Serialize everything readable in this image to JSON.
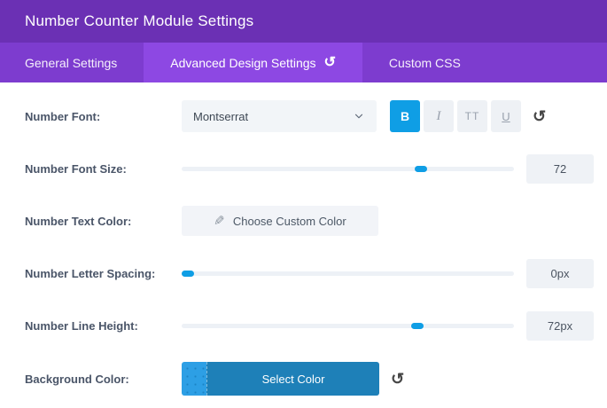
{
  "window": {
    "title": "Number Counter Module Settings"
  },
  "tabs": [
    {
      "label": "General Settings",
      "active": false
    },
    {
      "label": "Advanced Design Settings",
      "active": true,
      "has_reset": true
    },
    {
      "label": "Custom CSS",
      "active": false
    }
  ],
  "icons": {
    "reset": "↺",
    "pencil": "✎"
  },
  "colors": {
    "header_purple": "#6b30b4",
    "tabbar_purple": "#7d3ccf",
    "active_tab_purple": "#8d48e3",
    "accent_blue": "#0f9ee5",
    "swatch_blue": "#2d9fe5",
    "select_color_blue": "#1e80b8"
  },
  "settings": {
    "number_font": {
      "label": "Number Font:",
      "value": "Montserrat",
      "styles": [
        {
          "label": "B",
          "active": true
        },
        {
          "label": "I",
          "active": false
        },
        {
          "label": "TT",
          "active": false
        },
        {
          "label": "U",
          "active": false
        }
      ]
    },
    "number_font_size": {
      "label": "Number Font Size:",
      "value": "72",
      "slider_left": "70%"
    },
    "number_text_color": {
      "label": "Number Text Color:",
      "button_label": "Choose Custom Color"
    },
    "number_letter_spacing": {
      "label": "Number Letter Spacing:",
      "value": "0px",
      "slider_left": "0%"
    },
    "number_line_height": {
      "label": "Number Line Height:",
      "value": "72px",
      "slider_left": "69%"
    },
    "background_color": {
      "label": "Background Color:",
      "button_label": "Select Color"
    }
  }
}
